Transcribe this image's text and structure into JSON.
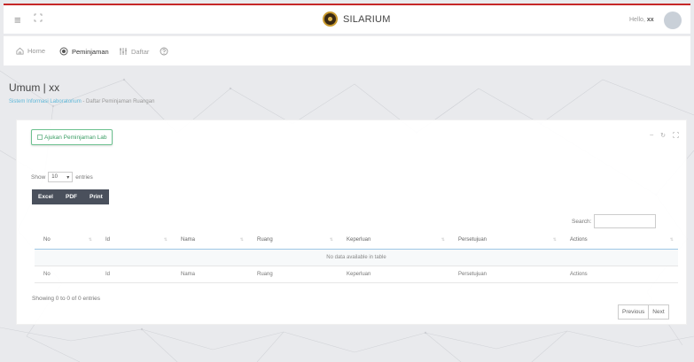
{
  "topbar": {
    "brand": "SILARIUM",
    "hello_prefix": "Hello, ",
    "hello_user": "xx"
  },
  "nav": {
    "home": "Home",
    "peminjaman": "Peminjaman",
    "daftar": "Daftar"
  },
  "page": {
    "title": "Umum | xx",
    "breadcrumb_link": "Sistem Informasi Laboratorium",
    "breadcrumb_sep": " - ",
    "breadcrumb_current": "Daftar Peminjaman Ruangan"
  },
  "card": {
    "ajukan_button": "Ajukan Peminjaman Lab",
    "show_label": "Show",
    "entries_value": "10",
    "entries_label": "entries",
    "export": {
      "excel": "Excel",
      "pdf": "PDF",
      "print": "Print"
    },
    "search_label": "Search:",
    "columns": [
      "No",
      "Id",
      "Nama",
      "Ruang",
      "Keperluan",
      "Persetujuan",
      "Actions"
    ],
    "empty_text": "No data available in table",
    "info": "Showing 0 to 0 of 0 entries",
    "pager": {
      "previous": "Previous",
      "next": "Next"
    }
  }
}
